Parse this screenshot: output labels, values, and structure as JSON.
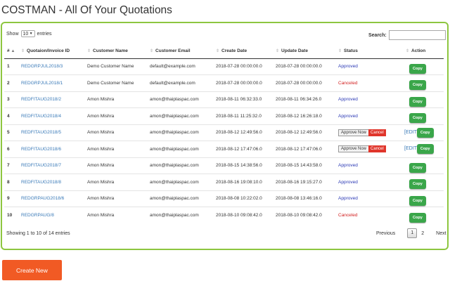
{
  "page": {
    "title": "COSTMAN - All Of Your Quotations"
  },
  "table_controls": {
    "show_label": "Show",
    "entries_value": "10",
    "entries_label": "entries",
    "search_label": "Search:",
    "search_value": ""
  },
  "columns": [
    "#",
    "Quotaion/Invoice ID",
    "Customer Name",
    "Customer Email",
    "Create Date",
    "Update Date",
    "Status",
    "Action"
  ],
  "rows": [
    {
      "no": "1",
      "id": "REDGRPJUL2018/3",
      "customer": "Demo Customer Name",
      "email": "default@example.com",
      "created": "2018-07-28 00:00:00.0",
      "updated": "2018-07-28 00:00:00.0",
      "status": "Approved",
      "action": "Copy"
    },
    {
      "no": "2",
      "id": "REDGRPJUL2018/1",
      "customer": "Demo Customer Name",
      "email": "default@example.com",
      "created": "2018-07-28 00:00:00.0",
      "updated": "2018-07-28 00:00:00.0",
      "status": "Canceled",
      "action": "Copy"
    },
    {
      "no": "3",
      "id": "REDFITAUG2018/2",
      "customer": "Amon Mishra",
      "email": "amon@thaiplaspac.com",
      "created": "2018-08-11 06:32:33.0",
      "updated": "2018-08-11 06:34:26.0",
      "status": "Approved",
      "action": "Copy"
    },
    {
      "no": "4",
      "id": "REDFITAUG2018/4",
      "customer": "Amon Mishra",
      "email": "amon@thaiplaspac.com",
      "created": "2018-08-11 11:25:32.0",
      "updated": "2018-08-12 16:26:18.0",
      "status": "Approved",
      "action": "Copy"
    },
    {
      "no": "5",
      "id": "REDFITAUG2018/5",
      "customer": "Amon Mishra",
      "email": "amon@thaiplaspac.com",
      "created": "2018-08-12 12:49:56.0",
      "updated": "2018-08-12 12:49:56.0",
      "status_approve": "Approve Now",
      "status_cancel": "Cancel",
      "edit": "[EDIT]",
      "action": "Copy"
    },
    {
      "no": "6",
      "id": "REDFITAUG2018/6",
      "customer": "Amon Mishra",
      "email": "amon@thaiplaspac.com",
      "created": "2018-08-12 17:47:06.0",
      "updated": "2018-08-12 17:47:06.0",
      "status_approve": "Approve Now",
      "status_cancel": "Cancel",
      "edit": "[EDIT]",
      "action": "Copy"
    },
    {
      "no": "7",
      "id": "REDFITAUG2018/7",
      "customer": "Amon Mishra",
      "email": "amon@thaiplaspac.com",
      "created": "2018-08-15 14:38:56.0",
      "updated": "2018-08-15 14:43:58.0",
      "status": "Approved",
      "action": "Copy"
    },
    {
      "no": "8",
      "id": "REDFITAUG2018/8",
      "customer": "Amon Mishra",
      "email": "amon@thaiplaspac.com",
      "created": "2018-08-16 19:08:10.0",
      "updated": "2018-08-16 19:15:27.0",
      "status": "Approved",
      "action": "Copy"
    },
    {
      "no": "9",
      "id": "REDGRPAUG2018/6",
      "customer": "Amon Mishra",
      "email": "amon@thaiplaspac.com",
      "created": "2018-08-08 10:22:02.0",
      "updated": "2018-08-08 13:46:16.0",
      "status": "Approved",
      "action": "Copy"
    },
    {
      "no": "10",
      "id": "REDGRPAUG/8",
      "customer": "Amon Mishra",
      "email": "amon@thaiplaspac.com",
      "created": "2018-08-10 09:08:42.0",
      "updated": "2018-08-10 09:08:42.0",
      "status": "Canceled",
      "action": "Copy"
    }
  ],
  "footer": {
    "showing": "Showing 1 to 10 of 14 entries",
    "previous": "Previous",
    "pages": [
      "1",
      "2"
    ],
    "next": "Next"
  },
  "create_button": "Create New",
  "colors": {
    "panel_border": "#8dc63f",
    "link": "#3a7ab8",
    "approved": "#2b39b5",
    "canceled": "#d21f1f",
    "copy_button": "#3aa64a",
    "cancel_button": "#e0352b",
    "create_button": "#f15a24"
  },
  "icons": {
    "sort": "sort-arrows-icon",
    "dropdown": "chevron-down-icon"
  }
}
